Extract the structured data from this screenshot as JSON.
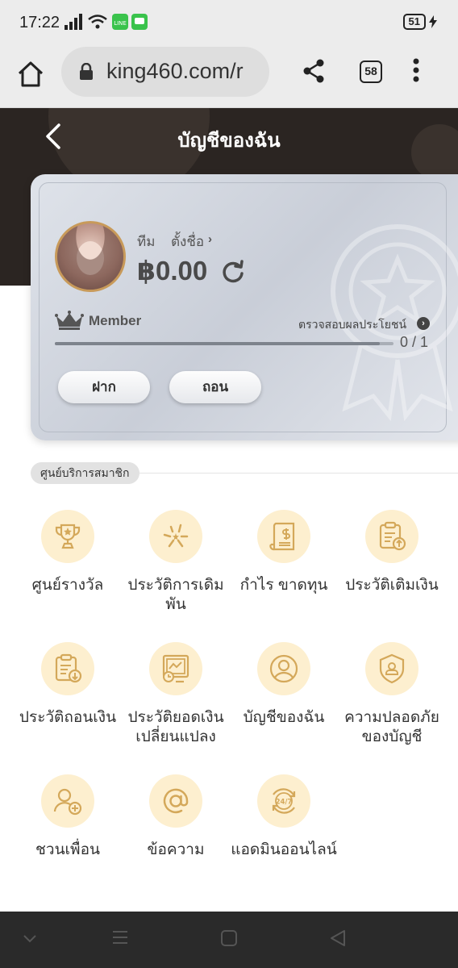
{
  "status_bar": {
    "time": "17:22",
    "battery": "51"
  },
  "browser": {
    "url": "king460.com/r",
    "tab_count": "58"
  },
  "header": {
    "title": "บัญชีของฉัน"
  },
  "card": {
    "username": "ทีม",
    "set_name": "ตั้งชื่อ",
    "balance": "฿0.00",
    "member_level": "Member",
    "benefits_link": "ตรวจสอบผลประโยชน์",
    "progress_text": "0 / 1",
    "progress_fraction": 0.96,
    "deposit_label": "ฝาก",
    "withdraw_label": "ถอน"
  },
  "section": {
    "title": "ศูนย์บริการสมาชิก",
    "items": [
      {
        "label": "ศูนย์รางวัล",
        "icon": "trophy-icon"
      },
      {
        "label": "ประวัติการเดิมพัน",
        "icon": "stars-icon"
      },
      {
        "label": "กำไร ขาดทุน",
        "icon": "receipt-icon"
      },
      {
        "label": "ประวัติเติมเงิน",
        "icon": "clipboard-upload-icon"
      },
      {
        "label": "ประวัติถอนเงิน",
        "icon": "clipboard-download-icon"
      },
      {
        "label": "ประวัติยอดเงินเปลี่ยนแปลง",
        "icon": "chart-clock-icon"
      },
      {
        "label": "บัญชีของฉัน",
        "icon": "user-circle-icon"
      },
      {
        "label": "ความปลอดภัยของบัญชี",
        "icon": "shield-user-icon"
      },
      {
        "label": "ชวนเพื่อน",
        "icon": "add-friend-icon"
      },
      {
        "label": "ข้อความ",
        "icon": "at-sign-icon"
      },
      {
        "label": "แอดมินออนไลน์",
        "icon": "support-24-7-icon"
      }
    ]
  },
  "colors": {
    "header_bg": "#2b2522",
    "icon_circle": "#fdefcf",
    "icon_stroke": "#d4a85a",
    "avatar_border": "#c89a5a"
  }
}
